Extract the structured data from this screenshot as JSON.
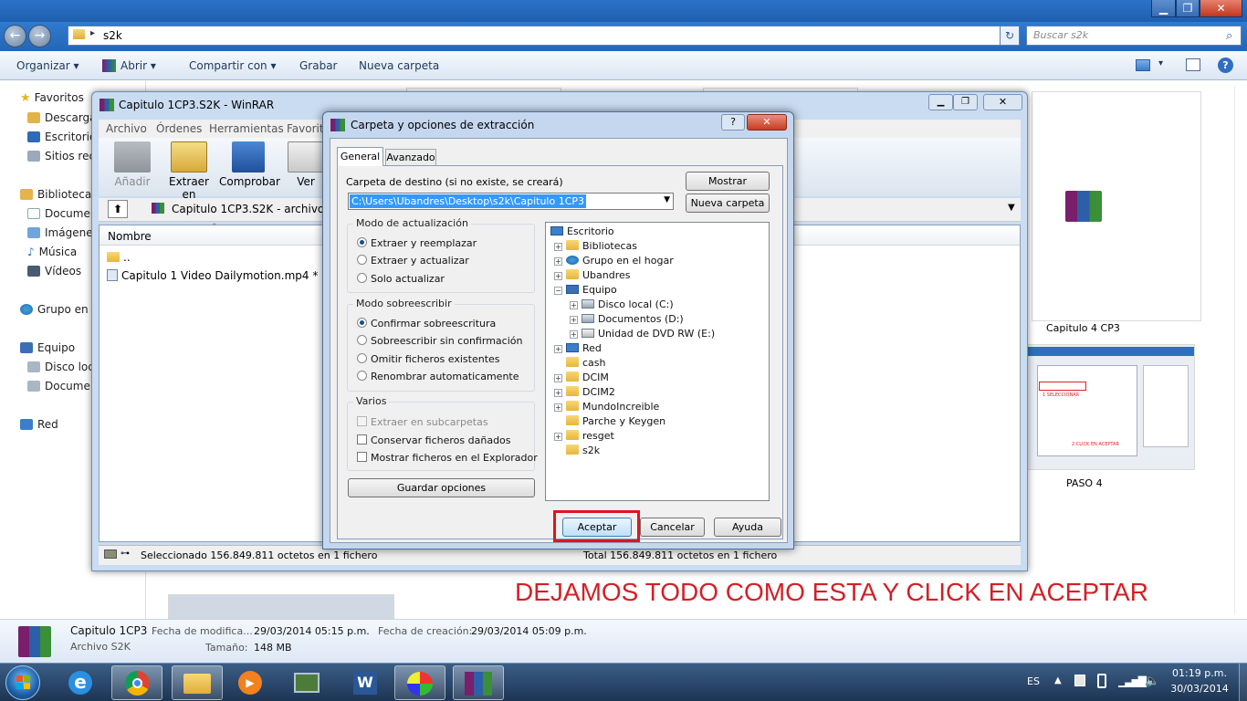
{
  "explorer": {
    "address": "s2k",
    "search_placeholder": "Buscar s2k",
    "window_controls": {
      "minimize": "▁",
      "maximize": "❐",
      "close": "✕"
    },
    "commands": {
      "organize": "Organizar",
      "open": "Abrir",
      "share": "Compartir con",
      "burn": "Grabar",
      "new_folder": "Nueva carpeta"
    },
    "nav": {
      "favorites": "Favoritos",
      "downloads": "Descarga",
      "desktop": "Escritorio",
      "recent": "Sitios reci",
      "libraries": "Bibliotecas",
      "documents": "Documen",
      "images": "Imágenes",
      "music": "Música",
      "videos": "Vídeos",
      "homegroup": "Grupo en e",
      "computer": "Equipo",
      "local_disk": "Disco loca",
      "documents_drive": "Documer",
      "network": "Red"
    },
    "content": {
      "item1_label": "Capitulo 4   CP3",
      "item2_label": "PASO 4",
      "thumb_text1": "1 SELECCIONAR",
      "thumb_text2": "2 CLICK EN ACEPTAR"
    },
    "details": {
      "name": "Capitulo 1CP3",
      "type": "Archivo S2K",
      "modified_label": "Fecha de modifica...",
      "modified_value": "29/03/2014 05:15 p.m.",
      "size_label": "Tamaño:",
      "size_value": "148 MB",
      "created_label": "Fecha de creación:",
      "created_value": "29/03/2014 05:09 p.m."
    }
  },
  "winrar": {
    "title": "Capitulo 1CP3.S2K - WinRAR",
    "menu": [
      "Archivo",
      "Órdenes",
      "Herramientas",
      "Favorito"
    ],
    "toolbar": {
      "add": "Añadir",
      "extract": "Extraer en",
      "test": "Comprobar",
      "view": "Ver"
    },
    "path": "Capitulo 1CP3.S2K - archivo RA",
    "column_name": "Nombre",
    "files": [
      {
        "name": ".."
      },
      {
        "name": "Capitulo 1    Video Dailymotion.mp4 *"
      }
    ],
    "status_left": "Seleccionado 156.849.811 octetos en 1 fichero",
    "status_right": "Total 156.849.811 octetos en 1 fichero"
  },
  "dialog": {
    "title": "Carpeta y opciones de extracción",
    "help_btn": "?",
    "close_btn": "✕",
    "tabs": {
      "general": "General",
      "advanced": "Avanzado"
    },
    "dest_label": "Carpeta de destino (si no existe, se creará)",
    "dest_value": "C:\\Users\\Ubandres\\Desktop\\s2k\\Capitulo 1CP3",
    "show_btn": "Mostrar",
    "new_folder_btn": "Nueva carpeta",
    "update_group": {
      "title": "Modo de actualización",
      "options": [
        "Extraer y reemplazar",
        "Extraer y actualizar",
        "Solo actualizar"
      ]
    },
    "overwrite_group": {
      "title": "Modo sobreescribir",
      "options": [
        "Confirmar sobreescritura",
        "Sobreescribir sin confirmación",
        "Omitir ficheros existentes",
        "Renombrar automaticamente"
      ]
    },
    "misc_group": {
      "title": "Varios",
      "options": [
        "Extraer en subcarpetas",
        "Conservar ficheros dañados",
        "Mostrar ficheros en el Explorador"
      ]
    },
    "save_btn": "Guardar opciones",
    "tree": {
      "desktop": "Escritorio",
      "libraries": "Bibliotecas",
      "homegroup": "Grupo en el hogar",
      "user": "Ubandres",
      "computer": "Equipo",
      "disk_c": "Disco local (C:)",
      "disk_d": "Documentos (D:)",
      "dvd_e": "Unidad de DVD RW (E:)",
      "network": "Red",
      "folders": [
        "cash",
        "DCIM",
        "DCIM2",
        "MundoIncreible",
        "Parche y Keygen",
        "resget",
        "s2k"
      ]
    },
    "ok_btn": "Aceptar",
    "cancel_btn": "Cancelar",
    "help_btn2": "Ayuda"
  },
  "annotation": "DEJAMOS TODO COMO ESTA Y CLICK EN ACEPTAR",
  "taskbar": {
    "lang": "ES",
    "time": "01:19 p.m.",
    "date": "30/03/2014"
  },
  "colors": {
    "annotation_red": "#d41f26",
    "highlight_red": "#e0141e",
    "selection_blue": "#3399ff"
  }
}
